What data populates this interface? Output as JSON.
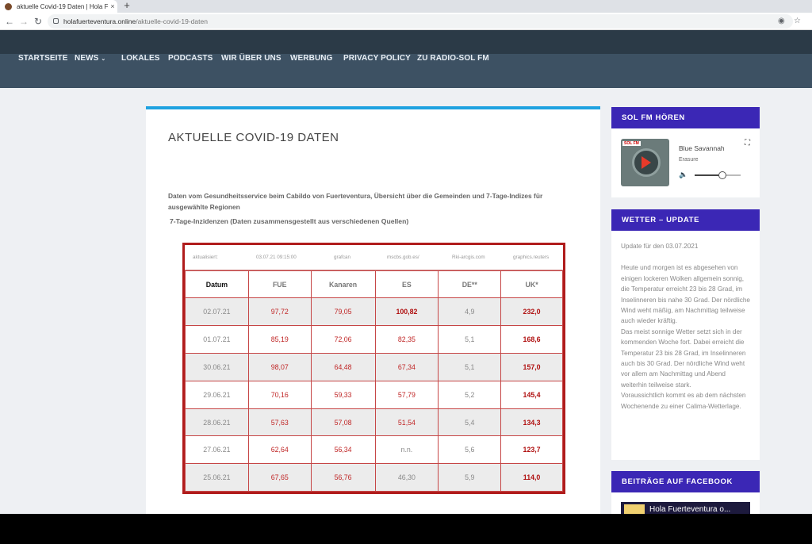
{
  "browser": {
    "tab_title": "aktuelle Covid-19 Daten | Hola F",
    "tab_close": "×",
    "new_tab": "+",
    "url_host": "holafuerteventura.online",
    "url_path": "/aktuelle-covid-19-daten"
  },
  "nav": {
    "items": [
      "STARTSEITE",
      "NEWS",
      "LOKALES",
      "PODCASTS",
      "WIR ÜBER UNS",
      "WERBUNG",
      "PRIVACY POLICY",
      "ZU RADIO-SOL FM"
    ]
  },
  "article": {
    "title": "AKTUELLE COVID-19 DATEN",
    "intro": "Daten vom Gesundheitsservice beim Cabildo von Fuerteventura, Übersicht über die Gemeinden und  7-Tage-Indizes für ausgewählte Regionen",
    "subhead": "7-Tage-Inzidenzen (Daten zusammensgestellt aus verschiedenen Quellen)"
  },
  "covid_table": {
    "meta": {
      "label": "aktualisiert:",
      "updated": "03.07.21  09:15:00",
      "src1": "grafcan",
      "src2": "mscbs.gob.es/",
      "src3": "Rki-arcgis.com",
      "src4": "graphics.reuters"
    },
    "headers": [
      "Datum",
      "FUE",
      "Kanaren",
      "ES",
      "DE**",
      "UK*"
    ],
    "rows": [
      [
        "02.07.21",
        "97,72",
        "79,05",
        "100,82",
        "4,9",
        "232,0"
      ],
      [
        "01.07.21",
        "85,19",
        "72,06",
        "82,35",
        "5,1",
        "168,6"
      ],
      [
        "30.06.21",
        "98,07",
        "64,48",
        "67,34",
        "5,1",
        "157,0"
      ],
      [
        "29.06.21",
        "70,16",
        "59,33",
        "57,79",
        "5,2",
        "145,4"
      ],
      [
        "28.06.21",
        "57,63",
        "57,08",
        "51,54",
        "5,4",
        "134,3"
      ],
      [
        "27.06.21",
        "62,64",
        "56,34",
        "n.n.",
        "5,6",
        "123,7"
      ],
      [
        "25.06.21",
        "67,65",
        "56,76",
        "46,30",
        "5,9",
        "114,0"
      ]
    ]
  },
  "sidebar": {
    "radio": {
      "heading": "SOL FM HÖREN",
      "song": "Blue Savannah",
      "artist": "Erasure",
      "volume_fraction": 0.6
    },
    "weather": {
      "heading": "WETTER – UPDATE",
      "updated": "Update für den 03.07.2021",
      "text": "Heute und morgen ist es abgesehen von einigen lockeren Wolken allgemein sonnig, die Temperatur erreicht 23 bis 28 Grad, im Inselinneren bis nahe 30 Grad. Der nördliche Wind weht mäßig, am Nachmittag teilweise auch wieder kräftig.",
      "text2": "Das meist sonnige Wetter setzt sich in der kommenden Woche fort. Dabei erreicht die Temperatur 23 bis 28 Grad, im Inselinneren auch bis 30 Grad. Der nördliche Wind weht vor allem am Nachmittag und Abend weiterhin teilweise stark.",
      "text3": "Voraussichtlich kommt es ab dem nächsten Wochenende zu einer Calima-Wetterlage."
    },
    "facebook": {
      "heading": "BEITRÄGE AUF FACEBOOK",
      "banner": "Hola Fuerteventura o..."
    }
  }
}
